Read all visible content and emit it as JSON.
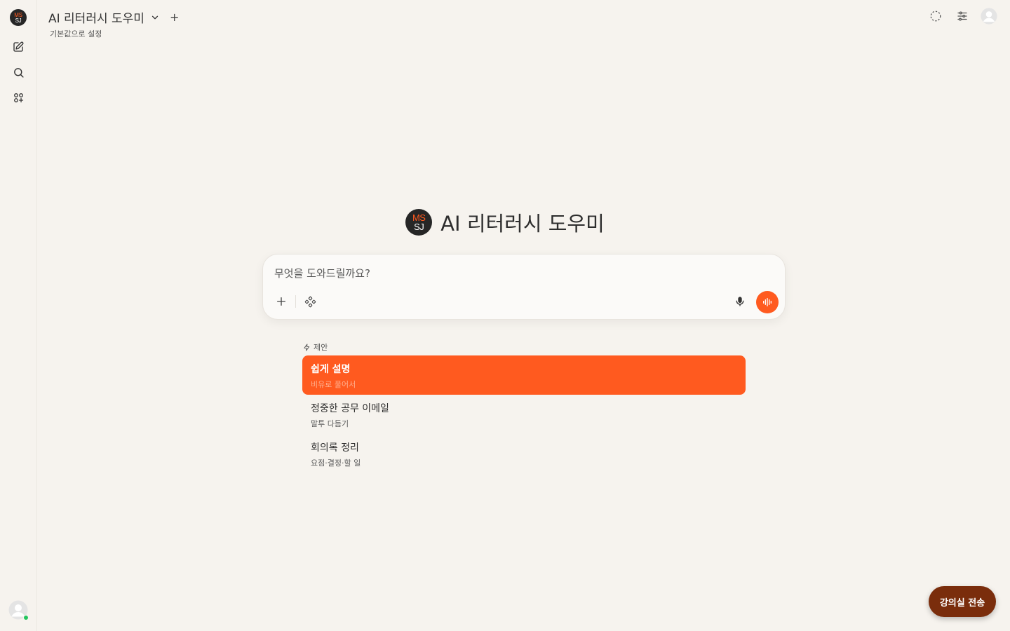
{
  "sidebar": {
    "logo_top": "MS",
    "logo_bottom": "SJ"
  },
  "header": {
    "model_name": "AI 리터러시 도우미",
    "model_sub": "기본값으로 설정",
    "add_label": "+"
  },
  "hero": {
    "logo_top": "MS",
    "logo_bottom": "SJ",
    "title": "AI 리터러시 도우미"
  },
  "composer": {
    "placeholder": "무엇을 도와드릴까요?",
    "value": ""
  },
  "suggestions": {
    "heading": "제안",
    "items": [
      {
        "title": "쉽게 설명",
        "subtitle": "비유로 풀어서"
      },
      {
        "title": "정중한 공무 이메일",
        "subtitle": "말투 다듬기"
      },
      {
        "title": "회의록 정리",
        "subtitle": "요점·결정·할 일"
      }
    ]
  },
  "fab": {
    "label": "강의실 전송"
  },
  "colors": {
    "accent": "#ff5a1f",
    "background": "#f6f3ee",
    "fab": "#7a2d0c"
  }
}
